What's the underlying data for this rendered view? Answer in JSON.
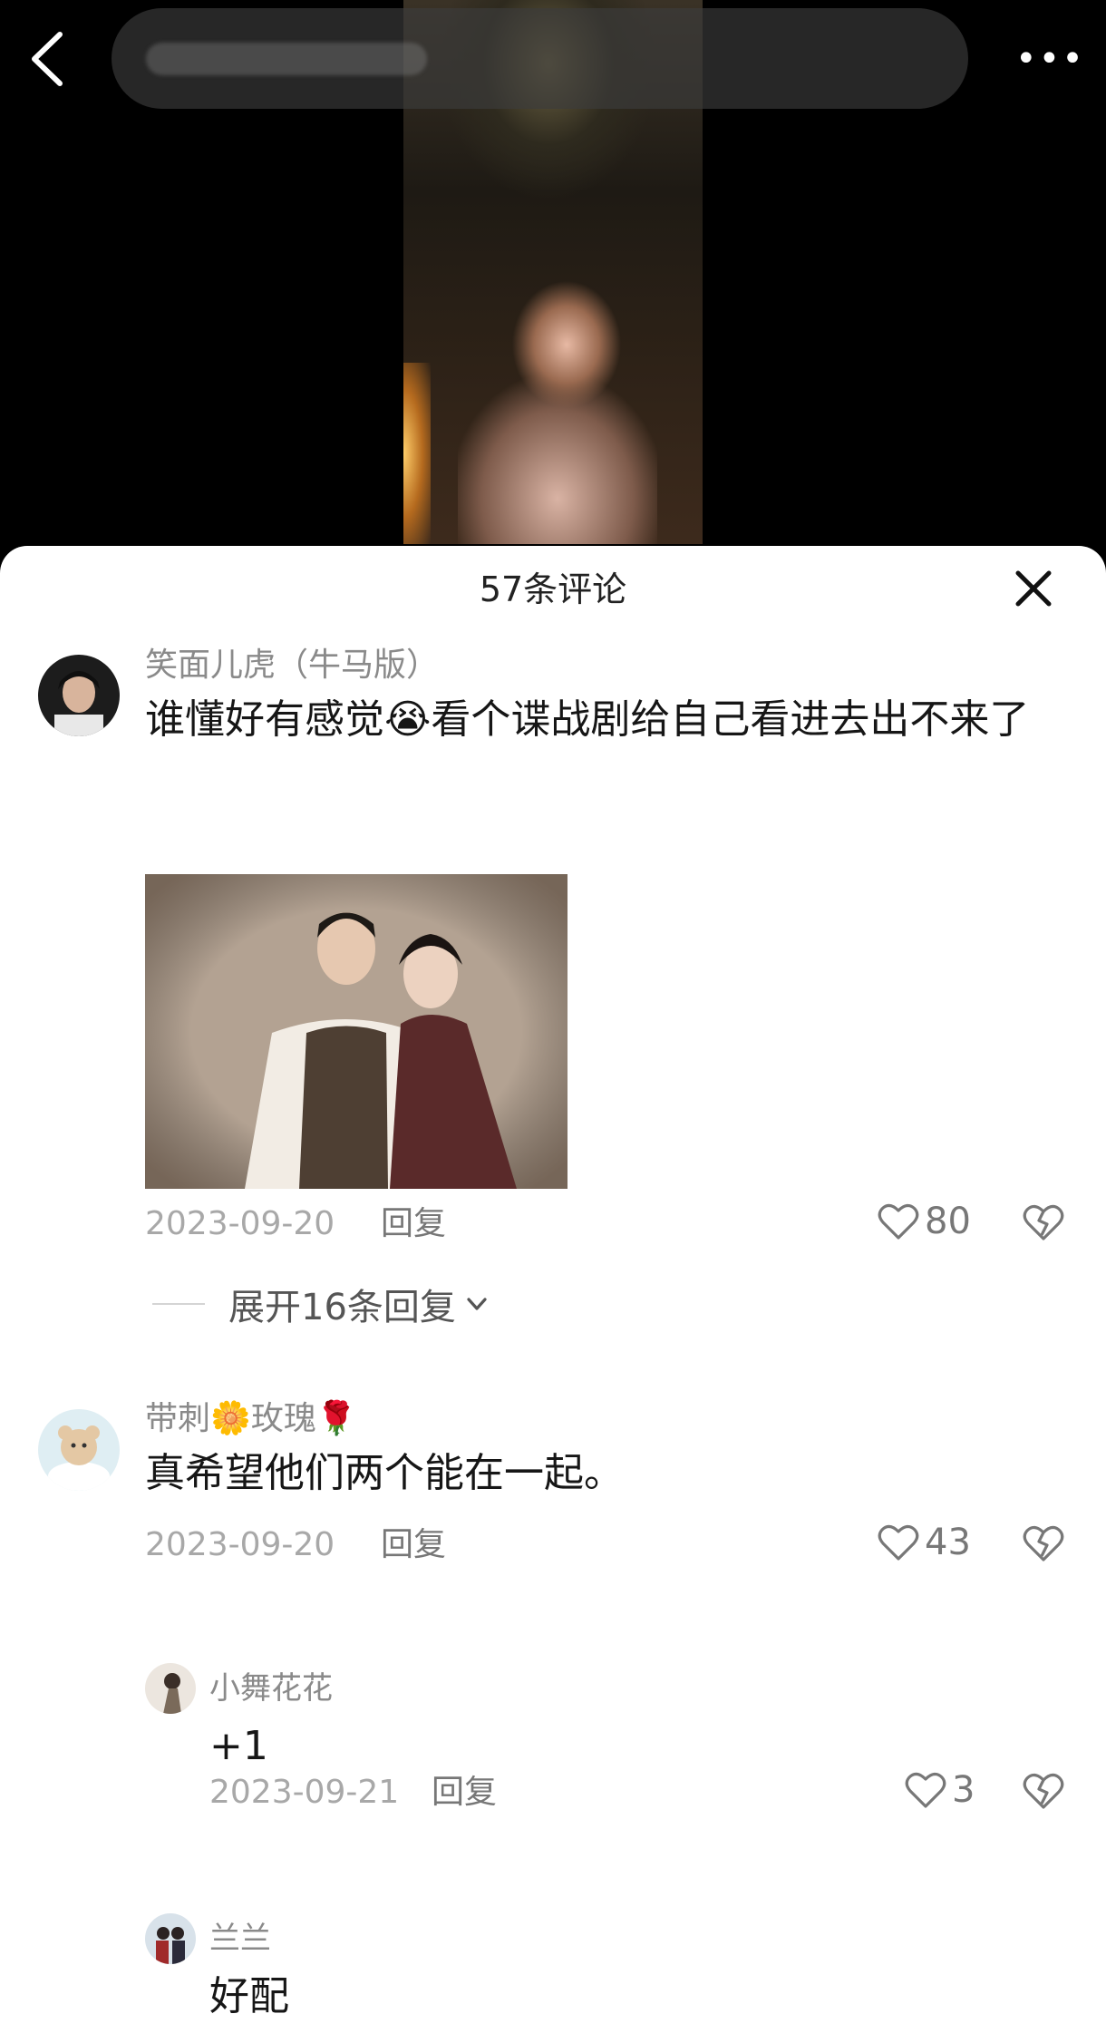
{
  "header": {
    "back_icon": "chevron-left-icon",
    "more_label": "•••"
  },
  "sheet": {
    "title": "57条评论",
    "close_icon": "close-icon"
  },
  "comments": [
    {
      "name": "笑面儿虎（牛马版）",
      "content": "谁懂好有感觉😭看个谍战剧给自己看进去出不来了",
      "date": "2023-09-20",
      "reply_label": "回复",
      "likes": "80",
      "expand_label": "展开16条回复"
    },
    {
      "name": "带刺🌼玫瑰🌹",
      "content": "真希望他们两个能在一起。",
      "date": "2023-09-20",
      "reply_label": "回复",
      "likes": "43",
      "replies": [
        {
          "name": "小舞花花",
          "content": "+1",
          "date": "2023-09-21",
          "reply_label": "回复",
          "likes": "3"
        },
        {
          "name": "兰兰",
          "content": "好配"
        }
      ]
    }
  ]
}
